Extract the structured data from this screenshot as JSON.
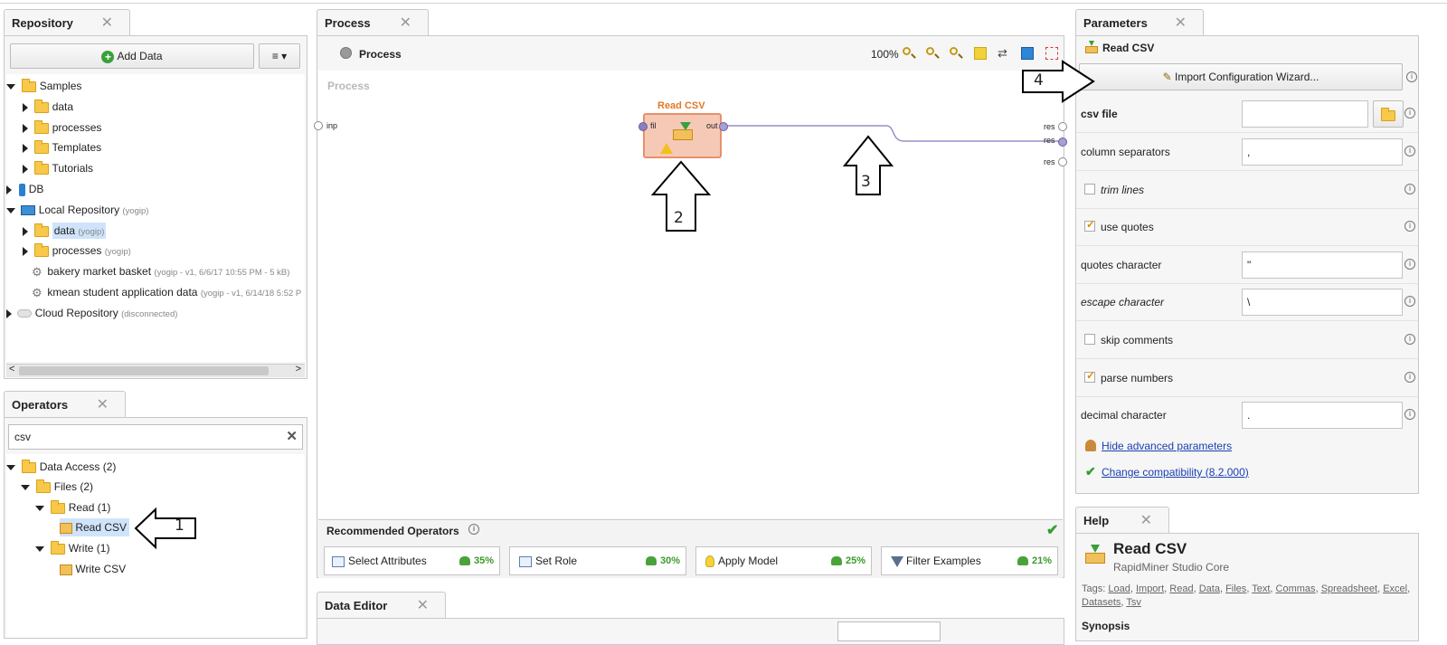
{
  "repository": {
    "tab_label": "Repository",
    "add_data_label": "Add Data",
    "tree": [
      {
        "label": "Samples",
        "sub": ""
      },
      {
        "label": "data",
        "sub": ""
      },
      {
        "label": "processes",
        "sub": ""
      },
      {
        "label": "Templates",
        "sub": ""
      },
      {
        "label": "Tutorials",
        "sub": ""
      },
      {
        "label": "DB",
        "sub": ""
      },
      {
        "label": "Local Repository",
        "sub": "(yogip)"
      },
      {
        "label": "data",
        "sub": "(yogip)"
      },
      {
        "label": "processes",
        "sub": "(yogip)"
      },
      {
        "label": "bakery market basket",
        "sub": "(yogip - v1, 6/6/17 10:55 PM - 5 kB)"
      },
      {
        "label": "kmean student application data",
        "sub": "(yogip - v1, 6/14/18 5:52 P"
      },
      {
        "label": "Cloud Repository",
        "sub": "(disconnected)"
      }
    ]
  },
  "operators": {
    "tab_label": "Operators",
    "search_value": "csv",
    "tree": [
      {
        "label": "Data Access (2)"
      },
      {
        "label": "Files (2)"
      },
      {
        "label": "Read (1)"
      },
      {
        "label": "Read CSV"
      },
      {
        "label": "Write (1)"
      },
      {
        "label": "Write CSV"
      }
    ]
  },
  "process": {
    "tab_label": "Process",
    "header_label": "Process",
    "zoom": "100%",
    "canvas_label": "Process",
    "operator_title": "Read CSV",
    "port_in": "fil",
    "port_out": "out",
    "left_port": "inp",
    "res_ports": [
      "res",
      "res",
      "res"
    ]
  },
  "recommended": {
    "title": "Recommended Operators",
    "items": [
      {
        "label": "Select Attributes",
        "pct": "35%"
      },
      {
        "label": "Set Role",
        "pct": "30%"
      },
      {
        "label": "Apply Model",
        "pct": "25%"
      },
      {
        "label": "Filter Examples",
        "pct": "21%"
      }
    ]
  },
  "data_editor": {
    "tab_label": "Data Editor"
  },
  "parameters": {
    "tab_label": "Parameters",
    "operator_label": "Read CSV",
    "wizard_label": "Import Configuration Wizard...",
    "rows": [
      {
        "label": "csv file",
        "value": ""
      },
      {
        "label": "column separators",
        "value": ","
      },
      {
        "label": "trim lines",
        "checked": false
      },
      {
        "label": "use quotes",
        "checked": true
      },
      {
        "label": "quotes character",
        "value": "\""
      },
      {
        "label": "escape character",
        "value": "\\"
      },
      {
        "label": "skip comments",
        "checked": false
      },
      {
        "label": "parse numbers",
        "checked": true
      },
      {
        "label": "decimal character",
        "value": "."
      }
    ],
    "hide_advanced": "Hide advanced parameters",
    "change_compat": "Change compatibility (8.2.000)"
  },
  "help": {
    "tab_label": "Help",
    "title": "Read CSV",
    "subtitle": "RapidMiner Studio Core",
    "tags_label": "Tags:",
    "tags": [
      "Load",
      "Import",
      "Read",
      "Data",
      "Files",
      "Text",
      "Commas",
      "Spreadsheet",
      "Excel",
      "Datasets",
      "Tsv"
    ],
    "synopsis": "Synopsis"
  },
  "annotations": [
    "1",
    "2",
    "3",
    "4"
  ],
  "colors": {
    "operator_fill": "#f6c9b7",
    "operator_title": "#e07a2a",
    "accent_link": "#1a3fb0"
  }
}
